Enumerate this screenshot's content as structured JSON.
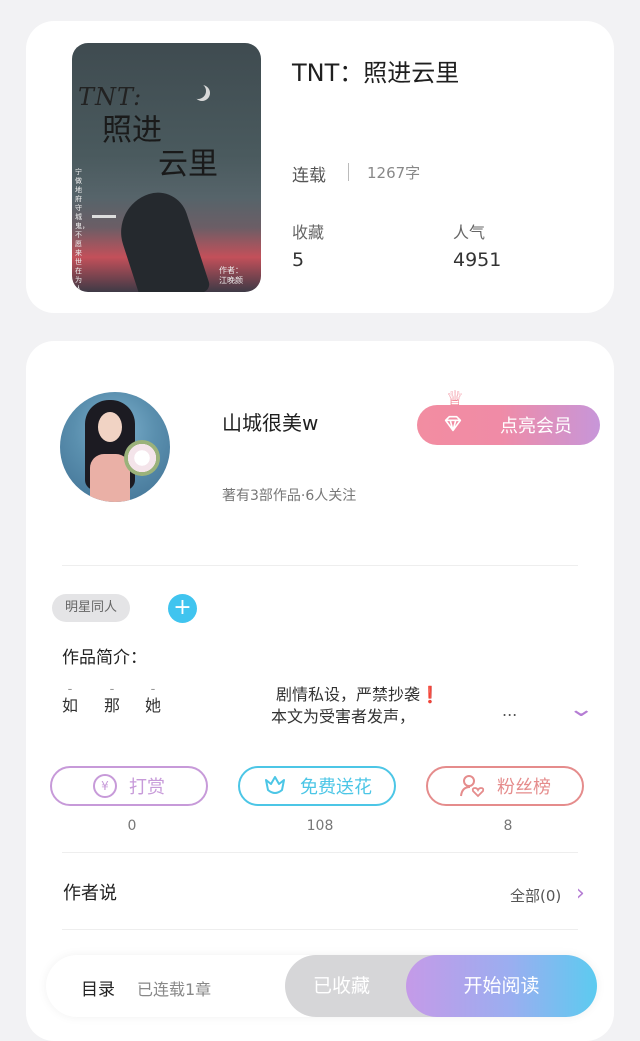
{
  "book": {
    "title": "TNT：照进云里",
    "status": "连载",
    "word_count": "1267字",
    "cover": {
      "script_title": "TNT:",
      "title_line1": "照进",
      "title_line2": "云里",
      "side_text": "宁做地府守城鬼，不愿来世在为人",
      "author_line1": "作者：",
      "author_line2": "江晚颜"
    },
    "stats": [
      {
        "label": "收藏",
        "value": "5"
      },
      {
        "label": "人气",
        "value": "4951"
      }
    ]
  },
  "author": {
    "name": "山城很美w",
    "meta": "著有3部作品·6人关注",
    "vip_label": "点亮会员"
  },
  "tag": "明星同人",
  "intro": {
    "heading": "作品简介：",
    "chars": [
      {
        "top": "-",
        "bottom": "如"
      },
      {
        "top": "-",
        "bottom": "那"
      },
      {
        "top": "-",
        "bottom": "她"
      }
    ],
    "line1": "剧情私设，严禁抄袭❗",
    "line2": "本文为受害者发声，",
    "ellipsis": "..."
  },
  "actions": [
    {
      "label": "打赏",
      "icon": "yen-icon",
      "count": "0",
      "color": "#c79ad9"
    },
    {
      "label": "免费送花",
      "icon": "flower-icon",
      "count": "108",
      "color": "#4cc6e6"
    },
    {
      "label": "粉丝榜",
      "icon": "fan-icon",
      "count": "8",
      "color": "#e58c8c"
    }
  ],
  "author_say": {
    "heading": "作者说",
    "all_label": "全部(0)"
  },
  "bottom": {
    "toc_label": "目录",
    "toc_status": "已连载1章",
    "collected_label": "已收藏",
    "start_label": "开始阅读"
  }
}
